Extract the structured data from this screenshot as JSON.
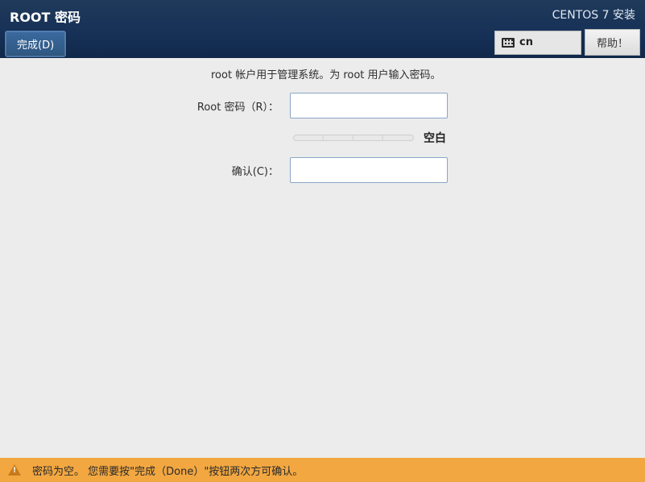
{
  "header": {
    "page_title": "ROOT 密码",
    "done_label": "完成(D)",
    "installer_title": "CENTOS 7 安装",
    "keyboard_layout": "cn",
    "help_label": "帮助！"
  },
  "body": {
    "instruction": "root 帐户用于管理系统。为 root 用户输入密码。",
    "password_label": "Root 密码（R）：",
    "confirm_label": "确认(C)：",
    "password_value": "",
    "confirm_value": "",
    "strength_label": "空白"
  },
  "warning": {
    "text": "密码为空。 您需要按\"完成（Done）\"按钮两次方可确认。"
  }
}
